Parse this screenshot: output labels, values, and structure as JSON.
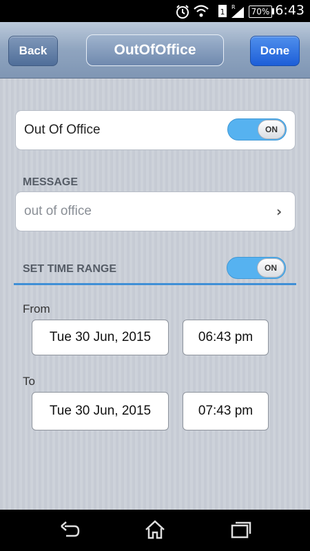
{
  "status_bar": {
    "time": "6:43",
    "battery": "70%",
    "icons": [
      "alarm-icon",
      "wifi-icon",
      "signal-icon",
      "battery-icon"
    ]
  },
  "nav": {
    "back_label": "Back",
    "title": "OutOfOffice",
    "done_label": "Done"
  },
  "out_of_office": {
    "label": "Out Of Office",
    "toggle_state": "ON"
  },
  "message": {
    "header": "MESSAGE",
    "value": "out of office"
  },
  "time_range": {
    "header": "SET TIME RANGE",
    "toggle_state": "ON",
    "from_label": "From",
    "from_date": "Tue 30 Jun, 2015",
    "from_time": "06:43 pm",
    "to_label": "To",
    "to_date": "Tue 30 Jun, 2015",
    "to_time": "07:43 pm"
  },
  "system_nav": {
    "icons": [
      "back-icon",
      "home-icon",
      "recent-apps-icon"
    ]
  },
  "colors": {
    "accent": "#3f8fd6",
    "toggle_on": "#56b2f0",
    "done_button": "#1d5ed8"
  }
}
